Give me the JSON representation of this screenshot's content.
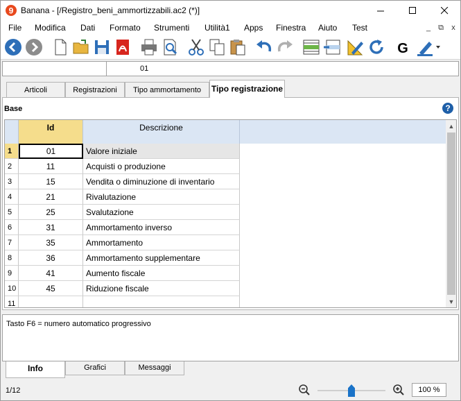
{
  "window": {
    "title": "Banana - [/Registro_beni_ammortizzabili.ac2 (*)]",
    "minimize_icon": "minimize-icon",
    "maximize_icon": "maximize-icon",
    "close_icon": "close-icon"
  },
  "menu": {
    "items": [
      "File",
      "Modifica",
      "Dati",
      "Formato",
      "Strumenti",
      "Utilità1",
      "Apps",
      "Finestra",
      "Aiuto",
      "Test"
    ],
    "mdi_buttons": [
      "_",
      "⧉",
      "x"
    ]
  },
  "toolbar": {
    "icons": [
      "back-icon",
      "forward-icon",
      "new-file-icon",
      "open-folder-icon",
      "save-icon",
      "pdf-icon",
      "print-icon",
      "print-preview-icon",
      "cut-icon",
      "copy-icon",
      "paste-icon",
      "undo-icon",
      "redo-icon",
      "insert-row-icon",
      "delete-row-icon",
      "edit-pencil-icon",
      "refresh-icon",
      "g-icon",
      "highlighter-icon"
    ]
  },
  "cellbar": {
    "value": "01"
  },
  "tabs": [
    "Articoli",
    "Registrazioni",
    "Tipo ammortamento",
    "Tipo registrazione"
  ],
  "active_tab": "Tipo registrazione",
  "section": {
    "label": "Base",
    "help": "?"
  },
  "grid": {
    "headers": {
      "id": "Id",
      "description": "Descrizione"
    },
    "rows": [
      {
        "num": "1",
        "id": "01",
        "desc": "Valore iniziale"
      },
      {
        "num": "2",
        "id": "11",
        "desc": "Acquisti o produzione"
      },
      {
        "num": "3",
        "id": "15",
        "desc": "Vendita o diminuzione di inventario"
      },
      {
        "num": "4",
        "id": "21",
        "desc": "Rivalutazione"
      },
      {
        "num": "5",
        "id": "25",
        "desc": "Svalutazione"
      },
      {
        "num": "6",
        "id": "31",
        "desc": "Ammortamento inverso"
      },
      {
        "num": "7",
        "id": "35",
        "desc": "Ammortamento"
      },
      {
        "num": "8",
        "id": "36",
        "desc": "Ammortamento supplementare"
      },
      {
        "num": "9",
        "id": "41",
        "desc": "Aumento fiscale"
      },
      {
        "num": "10",
        "id": "45",
        "desc": "Riduzione fiscale"
      },
      {
        "num": "11",
        "id": "",
        "desc": ""
      }
    ]
  },
  "info": {
    "text": "Tasto F6 = numero automatico progressivo"
  },
  "bottom_tabs": [
    "Info",
    "Grafici",
    "Messaggi"
  ],
  "status": {
    "row": "1/12",
    "zoom": "100 %",
    "zoom_level": 0.5
  },
  "colors": {
    "accent": "#1a73c8",
    "header": "#dbe6f4",
    "id_header": "#f5dd8c"
  }
}
